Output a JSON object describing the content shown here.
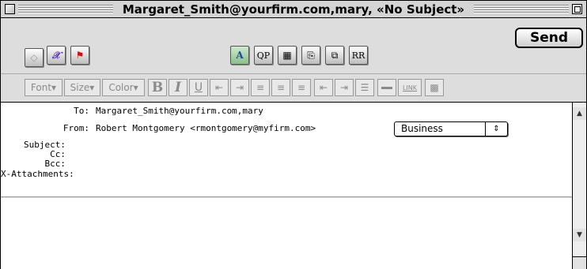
{
  "window": {
    "title": "Margaret_Smith@yourfirm.com,mary, «No Subject»"
  },
  "toolbar": {
    "buttons": [
      {
        "name": "signature-button",
        "icon": "signature-icon",
        "glyph": "◇"
      },
      {
        "name": "font-style-button",
        "icon": "text-style-icon",
        "glyph": "𝒳"
      },
      {
        "name": "priority-button",
        "icon": "priority-icon",
        "glyph": "⚑"
      },
      {
        "name": "spell-check-button",
        "icon": "spell-check-icon",
        "glyph": "A"
      },
      {
        "name": "quoted-printable-button",
        "icon": "quoted-printable-icon",
        "glyph": "QP"
      },
      {
        "name": "text-as-attachment-button",
        "icon": "attachment-icon",
        "glyph": "▦"
      },
      {
        "name": "keep-copies-button",
        "icon": "keep-copies-icon",
        "glyph": "⎘"
      },
      {
        "name": "word-wrap-button",
        "icon": "word-wrap-icon",
        "glyph": "⧉"
      },
      {
        "name": "return-receipt-button",
        "icon": "return-receipt-icon",
        "glyph": "RR"
      }
    ],
    "send_label": "Send"
  },
  "format_bar": {
    "font_label": "Font",
    "size_label": "Size",
    "color_label": "Color",
    "bold": "B",
    "italic": "I",
    "underline": "U",
    "link": "LINK",
    "dropdown_arrow": "▾"
  },
  "headers": {
    "to_label": "To:",
    "to_value": "Margaret_Smith@yourfirm.com,mary",
    "from_label": "From:",
    "from_value": "Robert Montgomery <rmontgomery@myfirm.com>",
    "subject_label": "Subject:",
    "subject_value": "",
    "cc_label": "Cc:",
    "cc_value": "",
    "bcc_label": "Bcc:",
    "bcc_value": "",
    "attachments_label": "X-Attachments:",
    "attachments_value": "",
    "persona": "Business",
    "persona_arrows": "⇕"
  },
  "scrollbar": {
    "up_arrow": "▲",
    "down_arrow": "▼"
  }
}
